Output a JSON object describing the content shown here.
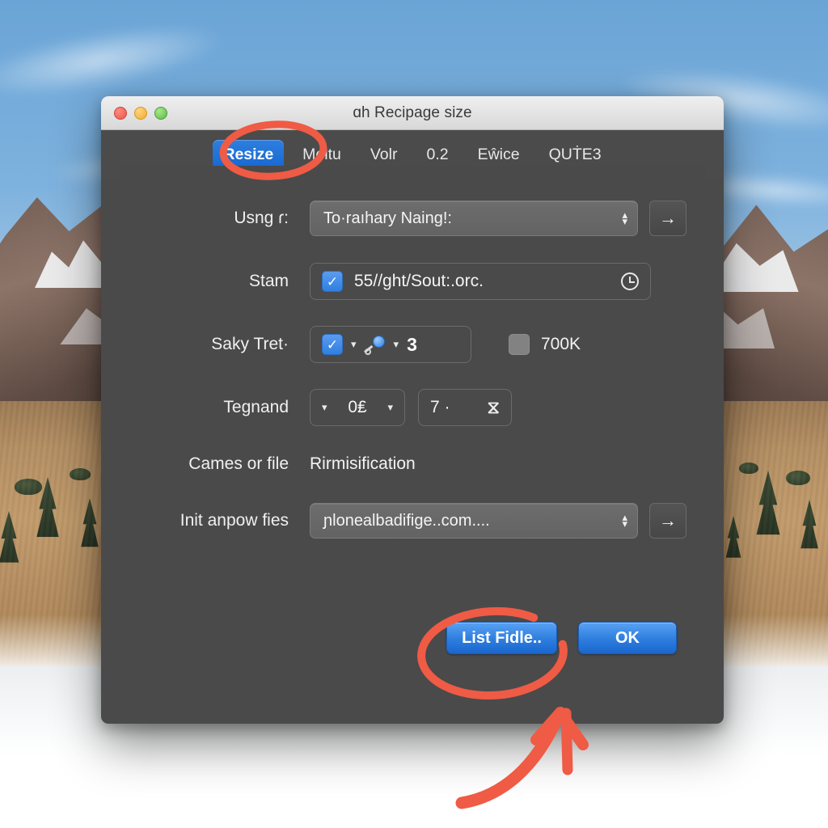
{
  "window": {
    "title": "ɑh Recipage size",
    "traffic_lights": [
      "close",
      "minimize",
      "zoom"
    ]
  },
  "tabs": [
    {
      "label": "Resize",
      "selected": true
    },
    {
      "label": "Meltu",
      "selected": false
    },
    {
      "label": "Volr",
      "selected": false
    },
    {
      "label": "0.2",
      "selected": false
    },
    {
      "label": "Eŵice",
      "selected": false
    },
    {
      "label": "QUṪE3",
      "selected": false
    }
  ],
  "form": {
    "row1": {
      "label": "Usng ɾ:",
      "combo_value": "To·raıhary Naing!:",
      "go_label": "→"
    },
    "row2": {
      "label": "Stam",
      "checkbox_checked": true,
      "check_glyph": "✓",
      "value": "55//ght/Sout:.orc.",
      "trailing_icon": "clock-icon"
    },
    "row3": {
      "label": "Saky Tret·",
      "checkbox_checked": true,
      "check_glyph": "✓",
      "caret_glyph": "▾",
      "key_icon": "key-icon",
      "number": "3",
      "extra_checkbox_checked": false,
      "extra_label": "700K"
    },
    "row4": {
      "label": "Tegnand",
      "left_caret": "▾",
      "stepper_value": "0₤",
      "right_caret": "▾",
      "second_value": "7 ·",
      "second_icon_glyph": "⧖"
    },
    "row5": {
      "label": "Cames or file",
      "value": "Rirmisification"
    },
    "row6": {
      "label": "Init anpow fies",
      "combo_value": "ɲlonealbadifige..com....",
      "go_label": "→"
    }
  },
  "footer": {
    "list_button": "List Fidle..",
    "ok_button": "OK"
  },
  "annotations": {
    "color": "#ef5b45",
    "circle_resize_tab": "ellipse-around-resize-tab",
    "circle_list_button": "ellipse-around-list-fidle-button",
    "arrow_to_list_button": "curved-arrow-pointing-to-list-fidle-button"
  },
  "colors": {
    "accent_blue": "#2f7fe0",
    "window_bg": "#4a4a4a",
    "titlebar": "#e4e3e3",
    "annotation_red": "#ef5b45"
  }
}
